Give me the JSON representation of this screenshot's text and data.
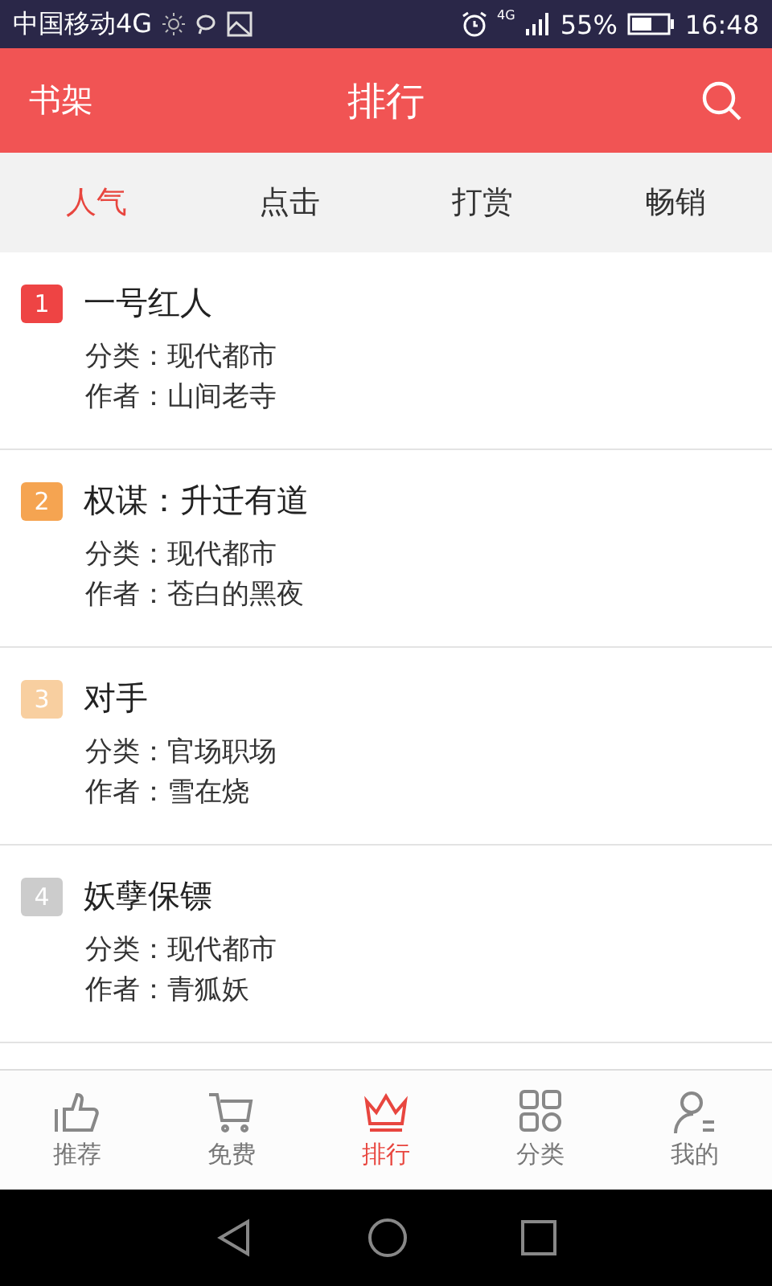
{
  "status_bar": {
    "carrier": "中国移动4G",
    "network": "4G",
    "battery": "55%",
    "time": "16:48"
  },
  "header": {
    "left": "书架",
    "title": "排行"
  },
  "tabs": [
    {
      "label": "人气",
      "selected": true
    },
    {
      "label": "点击",
      "selected": false
    },
    {
      "label": "打赏",
      "selected": false
    },
    {
      "label": "畅销",
      "selected": false
    }
  ],
  "books": [
    {
      "rank": "1",
      "color": "#ee4444",
      "title": "一号红人",
      "category_label": "分类：",
      "category": "现代都市",
      "author_label": "作者：",
      "author": "山间老寺"
    },
    {
      "rank": "2",
      "color": "#f5a451",
      "title": "权谋：升迁有道",
      "category_label": "分类：",
      "category": "现代都市",
      "author_label": "作者：",
      "author": "苍白的黑夜"
    },
    {
      "rank": "3",
      "color": "#f8cfa0",
      "title": "对手",
      "category_label": "分类：",
      "category": "官场职场",
      "author_label": "作者：",
      "author": "雪在烧"
    },
    {
      "rank": "4",
      "color": "#cccccc",
      "title": "妖孽保镖",
      "category_label": "分类：",
      "category": "现代都市",
      "author_label": "作者：",
      "author": "青狐妖"
    }
  ],
  "bottom_nav": [
    {
      "kind": "like",
      "label": "推荐",
      "selected": false
    },
    {
      "kind": "cart",
      "label": "免费",
      "selected": false
    },
    {
      "kind": "crown",
      "label": "排行",
      "selected": true
    },
    {
      "kind": "grid",
      "label": "分类",
      "selected": false
    },
    {
      "kind": "user",
      "label": "我的",
      "selected": false
    }
  ]
}
